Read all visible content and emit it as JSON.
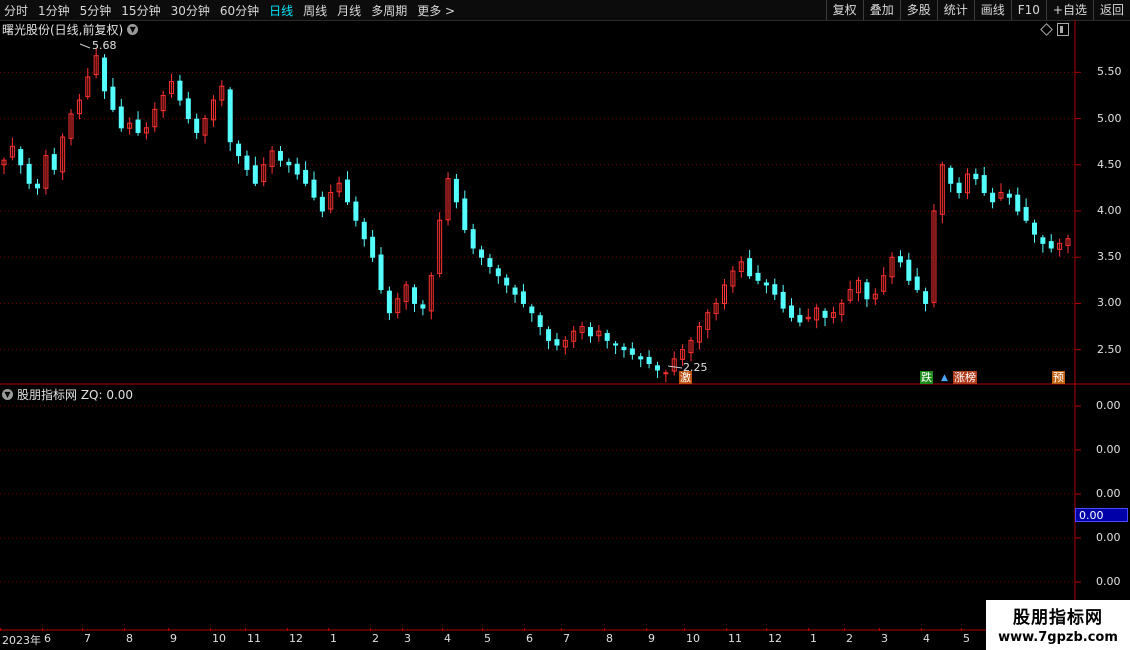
{
  "toolbar": {
    "periods": [
      "分时",
      "1分钟",
      "5分钟",
      "15分钟",
      "30分钟",
      "60分钟",
      "日线",
      "周线",
      "月线",
      "多周期",
      "更多 >"
    ],
    "active_period": "日线",
    "buttons": [
      "复权",
      "叠加",
      "多股",
      "统计",
      "画线",
      "F10",
      "+自选",
      "返回"
    ]
  },
  "main_chart": {
    "title": "曙光股份(日线,前复权)",
    "high_label": "5.68",
    "low_label": "2.25",
    "price_axis": [
      "5.50",
      "5.00",
      "4.50",
      "4.00",
      "3.50",
      "3.00",
      "2.50"
    ],
    "badges": {
      "fall": "跌",
      "rise": "涨榜",
      "pre": "预",
      "hot": "激"
    }
  },
  "indicator": {
    "title": "股朋指标网 ZQ: 0.00",
    "axis": [
      "0.00",
      "0.00",
      "0.00",
      "0.00",
      "0.00"
    ],
    "current_value": "0.00"
  },
  "date_axis": [
    "2023年",
    "6",
    "7",
    "8",
    "9",
    "10",
    "11",
    "12",
    "1",
    "2",
    "3",
    "4",
    "5",
    "6",
    "7",
    "8",
    "9",
    "10",
    "11",
    "12",
    "1",
    "2",
    "3",
    "4",
    "5"
  ],
  "watermark": {
    "line1": "股朋指标网",
    "line2": "www.7gpzb.com"
  },
  "chart_data": {
    "type": "candlestick",
    "y_range": [
      2.15,
      5.85
    ],
    "up_color": "#ff3232",
    "down_color": "#54ffff",
    "close_series": [
      4.55,
      4.7,
      4.5,
      4.3,
      4.25,
      4.6,
      4.45,
      4.8,
      5.05,
      5.2,
      5.45,
      5.68,
      5.3,
      5.1,
      4.9,
      4.95,
      4.85,
      4.9,
      5.1,
      5.25,
      5.4,
      5.2,
      5.0,
      4.85,
      5.0,
      5.2,
      5.35,
      4.75,
      4.6,
      4.45,
      4.3,
      4.5,
      4.65,
      4.55,
      4.5,
      4.4,
      4.3,
      4.15,
      4.0,
      4.2,
      4.3,
      4.1,
      3.9,
      3.7,
      3.5,
      3.15,
      2.9,
      3.05,
      3.2,
      3.0,
      2.95,
      3.3,
      3.9,
      4.35,
      4.1,
      3.8,
      3.6,
      3.5,
      3.4,
      3.3,
      3.2,
      3.1,
      3.0,
      2.9,
      2.75,
      2.6,
      2.55,
      2.6,
      2.7,
      2.75,
      2.65,
      2.7,
      2.6,
      2.55,
      2.5,
      2.45,
      2.4,
      2.35,
      2.28,
      2.25,
      2.4,
      2.5,
      2.6,
      2.75,
      2.9,
      3.0,
      3.2,
      3.35,
      3.45,
      3.3,
      3.25,
      3.2,
      3.1,
      2.95,
      2.85,
      2.8,
      2.85,
      2.95,
      2.85,
      2.9,
      3.0,
      3.15,
      3.25,
      3.05,
      3.1,
      3.3,
      3.5,
      3.45,
      3.25,
      3.15,
      3.0,
      4.0,
      4.5,
      4.3,
      4.2,
      4.4,
      4.35,
      4.2,
      4.1,
      4.2,
      4.15,
      4.0,
      3.9,
      3.75,
      3.65,
      3.6,
      3.65,
      3.7
    ]
  }
}
